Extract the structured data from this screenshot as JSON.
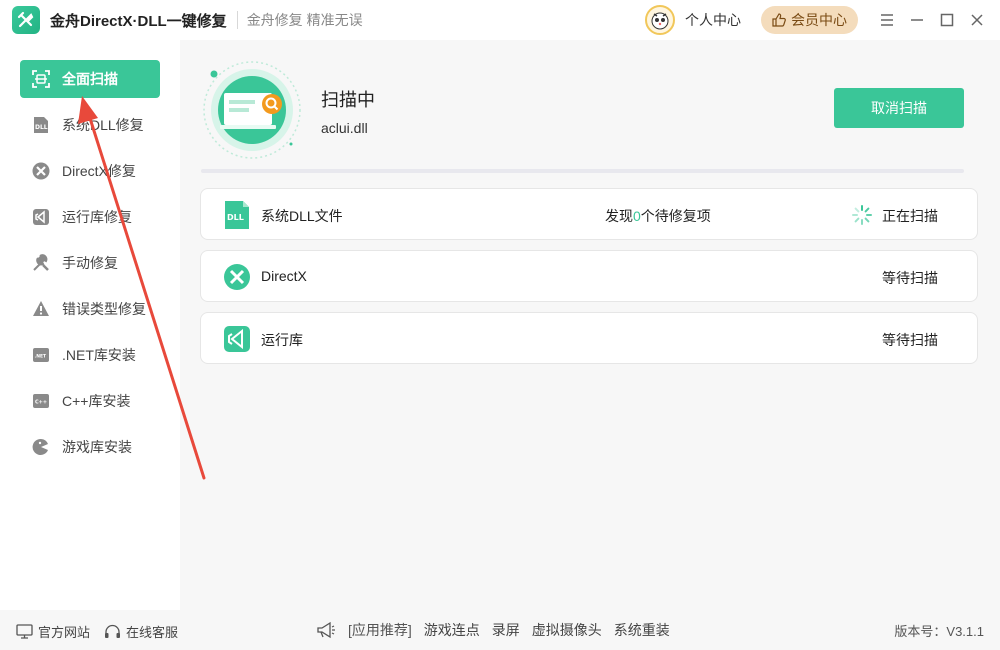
{
  "titlebar": {
    "app_title": "金舟DirectX·DLL一键修复",
    "slogan": "金舟修复 精准无误",
    "personal_center": "个人中心",
    "vip_center": "会员中心"
  },
  "sidebar": {
    "items": [
      {
        "label": "全面扫描",
        "icon": "scan-icon",
        "active": true
      },
      {
        "label": "系统DLL修复",
        "icon": "dll-file-icon"
      },
      {
        "label": "DirectX修复",
        "icon": "directx-icon"
      },
      {
        "label": "运行库修复",
        "icon": "runtime-icon"
      },
      {
        "label": "手动修复",
        "icon": "wrench-icon"
      },
      {
        "label": "错误类型修复",
        "icon": "warning-icon"
      },
      {
        "label": ".NET库安装",
        "icon": "dotnet-icon"
      },
      {
        "label": "C++库安装",
        "icon": "cpp-icon"
      },
      {
        "label": "游戏库安装",
        "icon": "game-icon"
      }
    ]
  },
  "scan": {
    "status": "扫描中",
    "current_file": "aclui.dll",
    "cancel_label": "取消扫描",
    "progress": 0
  },
  "results": {
    "rows": [
      {
        "name": "系统DLL文件",
        "found_prefix": "发现",
        "found_count": "0",
        "found_suffix": "个待修复项",
        "state": "正在扫描",
        "icon": "dll-file-icon",
        "spinning": true
      },
      {
        "name": "DirectX",
        "state": "等待扫描",
        "icon": "directx-icon"
      },
      {
        "name": "运行库",
        "state": "等待扫描",
        "icon": "runtime-icon"
      }
    ]
  },
  "footer": {
    "official_site": "官方网站",
    "online_service": "在线客服",
    "recommend_label": "[应用推荐]",
    "recommend_items": [
      "游戏连点",
      "录屏",
      "虚拟摄像头",
      "系统重装"
    ],
    "version": "版本号：V3.1.1"
  },
  "colors": {
    "accent": "#3ac698",
    "vip_bg": "#f4dcbc",
    "annotation": "#e8493b"
  }
}
